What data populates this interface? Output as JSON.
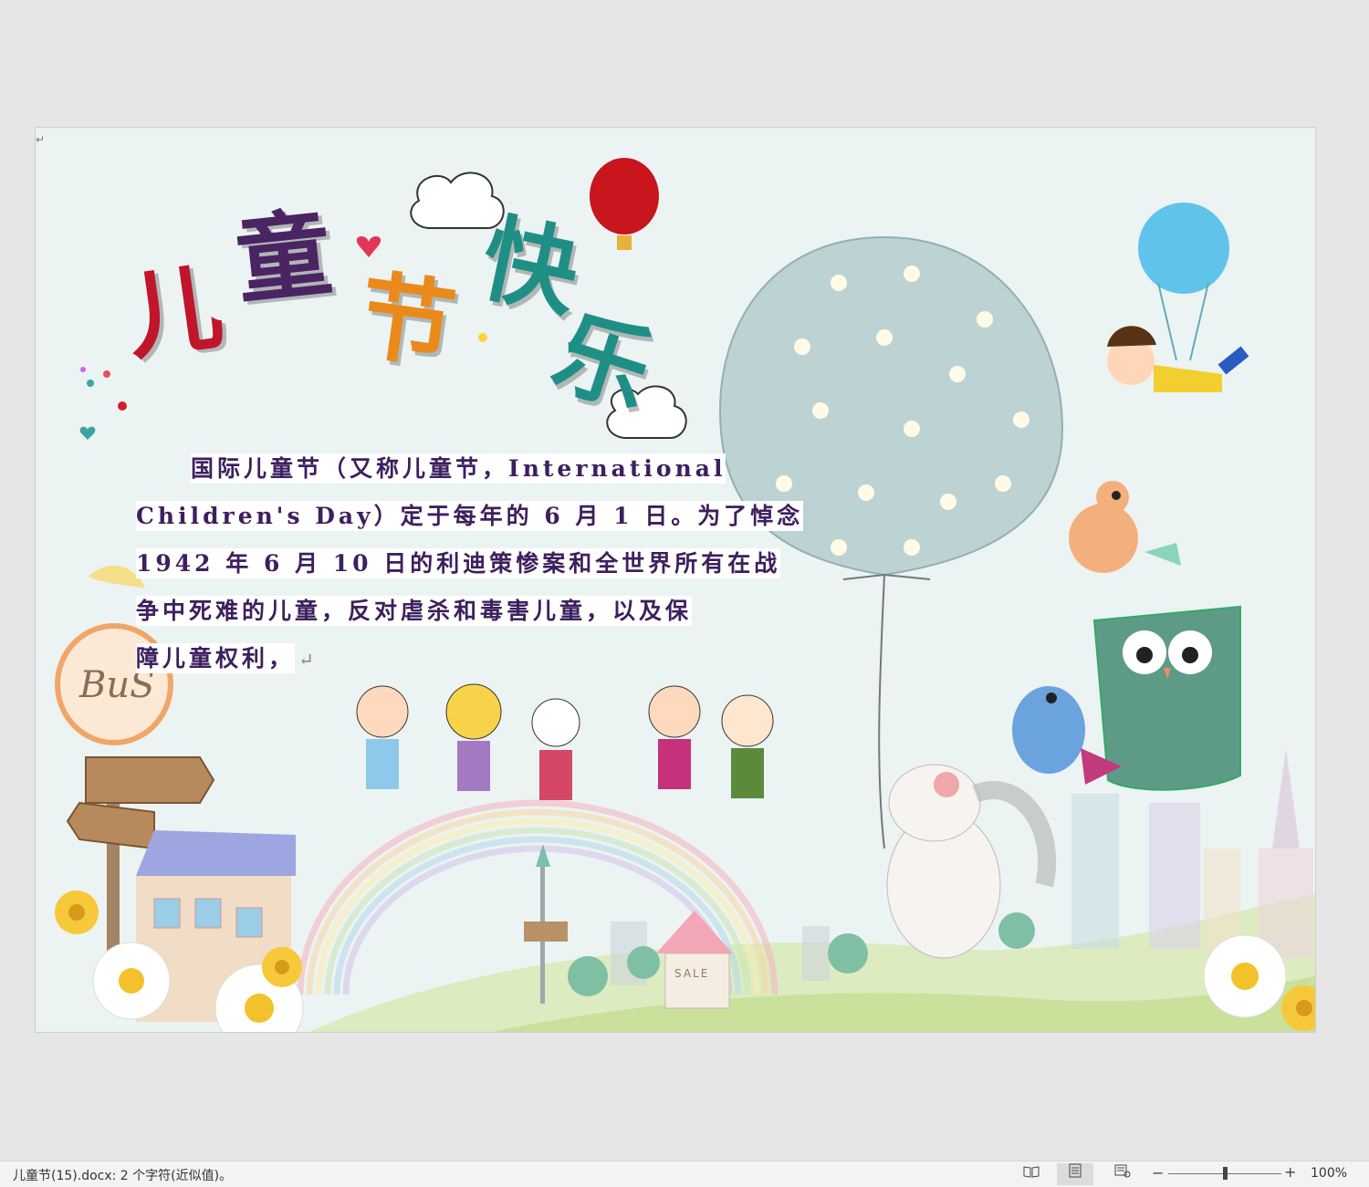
{
  "window": {
    "background": "#e6e6e6"
  },
  "document": {
    "paragraph_mark": "↵",
    "title_chars": [
      {
        "char": "儿",
        "color": "#c0152b"
      },
      {
        "char": "童",
        "color": "#4a2463"
      },
      {
        "char": "节",
        "color": "#ea8a1a"
      },
      {
        "char": "快",
        "color": "#1f8f86"
      },
      {
        "char": "乐",
        "color": "#1f8f86"
      }
    ],
    "body_lines": [
      "国际儿童节（又称儿童节，International",
      "Children's Day）定于每年的 6 月 1 日。为了悼念",
      "1942 年 6 月 10 日的利迪策惨案和全世界所有在战",
      "争中死难的儿童，反对虐杀和毒害儿童，以及保",
      "障儿童权利，"
    ],
    "bus_sign_text": "BuS",
    "sale_sign_text": "SALE",
    "colors": {
      "text": "#3d1f5e",
      "page_bg": "#ecf3f3"
    }
  },
  "statusbar": {
    "doc_info": "儿童节(15).docx: 2 个字符(近似值)。",
    "zoom_minus": "−",
    "zoom_plus": "+",
    "zoom_level": "100%",
    "zoom_fraction": 0.5,
    "icons": [
      "read-mode-icon",
      "print-layout-icon",
      "web-layout-icon"
    ]
  }
}
